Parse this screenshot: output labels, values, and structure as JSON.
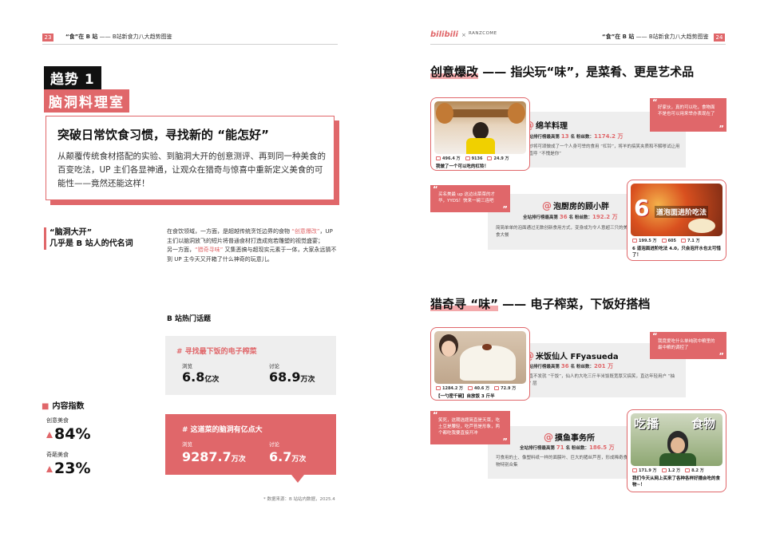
{
  "left": {
    "page_number": "23",
    "header": {
      "bold": "“食”在 B 站",
      "rest": " —— B站新食力八大趋势图鉴"
    },
    "trend_no": "趋势 1",
    "trend_name": "脑洞料理室",
    "headline": "突破日常饮食习惯，寻找新的 “能怎好”",
    "intro": "从颠覆传统食材搭配的实验、到脑洞大开的创意测评、再到同一种美食的百变吃法，UP 主们各显神通，让观众在猎奇与惊喜中重新定义美食的可能性——竟然还能这样！",
    "side_title_1": "“脑洞大开”",
    "side_title_2": "几乎是 B 站人的代名词",
    "body_1a": "在食饮领域，一方面，是超越传统烹饪边界的食物 ",
    "body_1_hl": "“创意爆改”",
    "body_1b": "，UP 主们以脑洞放飞的短片将普通食材打造成宛若雕塑的视觉盛宴；",
    "body_2a": "另一方面，",
    "body_2_hl": "“猎奇寻味”",
    "body_2b": " 又集恶搞与超现实元素于一体，大家永远猜不到 UP 主今天又开箱了什么神奇的玩意儿。",
    "hot_topics_title": "B 站热门话题",
    "topic1": {
      "name": "# 寻找最下饭的电子榨菜",
      "views_label": "浏览",
      "views": "6.8",
      "views_unit": "亿次",
      "disc_label": "讨论",
      "disc": "68.9",
      "disc_unit": "万次"
    },
    "topic2": {
      "name": "# 这道菜的脑洞有亿点大",
      "views_label": "浏览",
      "views": "9287.7",
      "views_unit": "万次",
      "disc_label": "讨论",
      "disc": "6.7",
      "disc_unit": "万次"
    },
    "index_title": "内容指数",
    "index1": {
      "label": "创意美食",
      "value": "84%"
    },
    "index2": {
      "label": "奇葩美食",
      "value": "23%"
    },
    "source": "* 数据来源：B 站站内数据，2025.4"
  },
  "right": {
    "page_number": "24",
    "logo_bili": "bilibili",
    "logo_x": "×",
    "logo_partner": "RANZCOME",
    "header": {
      "bold": "“食”在 B 站",
      "rest": " —— B站新食力八大趋势图鉴"
    },
    "sect1": {
      "hl": "创意爆改",
      "rest": " —— 指尖玩“味”，是菜肴、更是艺术品"
    },
    "sect2": {
      "hl_a": "猎奇寻 “味”",
      "rest": " —— 电子榨菜，下饭好搭档"
    },
    "c1": {
      "stats": [
        "496.4 万",
        "9136",
        "24.9 万"
      ],
      "caption": "我做了一个可以吃的杠铃！",
      "name": "绵羊料理",
      "rank_pre": "全站排行榜最高第 ",
      "rank": "13",
      "rank_mid": " 名    粉丝数：",
      "fans": "1174.2 万",
      "desc": "巧妙将可颂做成了一个人身可举的食用 “杠铃”，将羊的搞笑夹质和不解嗲试让用户直呼 “不愧是你”",
      "quote": "好家伙，真的可以吃，食物面不是也可以用来举办表现在了"
    },
    "c2": {
      "quote": "买名美最 up 这边出菜菜的才华，YYDS！快来一碗三连吧",
      "name": "泡厨房的顾小胖",
      "rank_pre": "全站排行榜最高第 ",
      "rank": "36",
      "rank_mid": " 名    粉丝数：",
      "fans": "192.2 万",
      "desc": "简简单单的泡面通过无数创新食用方式，变身成为令人意超三只的美食大餐",
      "thumb_big": "6",
      "thumb_text": "道泡面进阶吃法",
      "stats": [
        "199.5 万",
        "605",
        "7.1 万"
      ],
      "caption": "6 道泡面进阶吃法 4.0，只会泡开水也太可惜了！"
    },
    "c3": {
      "stats": [
        "1284.2 万",
        "40.6 万",
        "72.9 万"
      ],
      "caption": "【一勺密千碗】自放饭 3 斤半",
      "name": "米饭仙人 FFyasueda",
      "rank_pre": "全站排行榜最高第 ",
      "rank": "36",
      "rank_mid": " 名    粉丝数：",
      "fans": "201 万",
      "desc": "一直不发就 “干饭”，仙人的大吃三斤半米饭既宽厚又搞笑，直达年轻用户 “抽象” 层",
      "quote": "我竟爱吃什么单纯就中粮里的最中粮的调控了"
    },
    "c4": {
      "quote": "笑死，这期选题简直是天菜，吃土豆是腰轻，吃芦苔是形象，两个都吃我要直接开冲",
      "name": "摸鱼事务所",
      "rank_pre": "全站排行榜最高第 ",
      "rank": "71",
      "rank_mid": " 名    粉丝数：",
      "fans": "186.5 万",
      "desc": "可食用的土、像塑料纸一样的面膜叶、巨大的猪丝芦苔，形成稀奇食物特别合集",
      "thumb_text_a": "吃播",
      "thumb_text_b": "食物",
      "stats": [
        "171.9 万",
        "1.2 万",
        "8.2 万"
      ],
      "caption": "我们今天从网上买来了各种各样好播会吃的食物~！"
    }
  }
}
